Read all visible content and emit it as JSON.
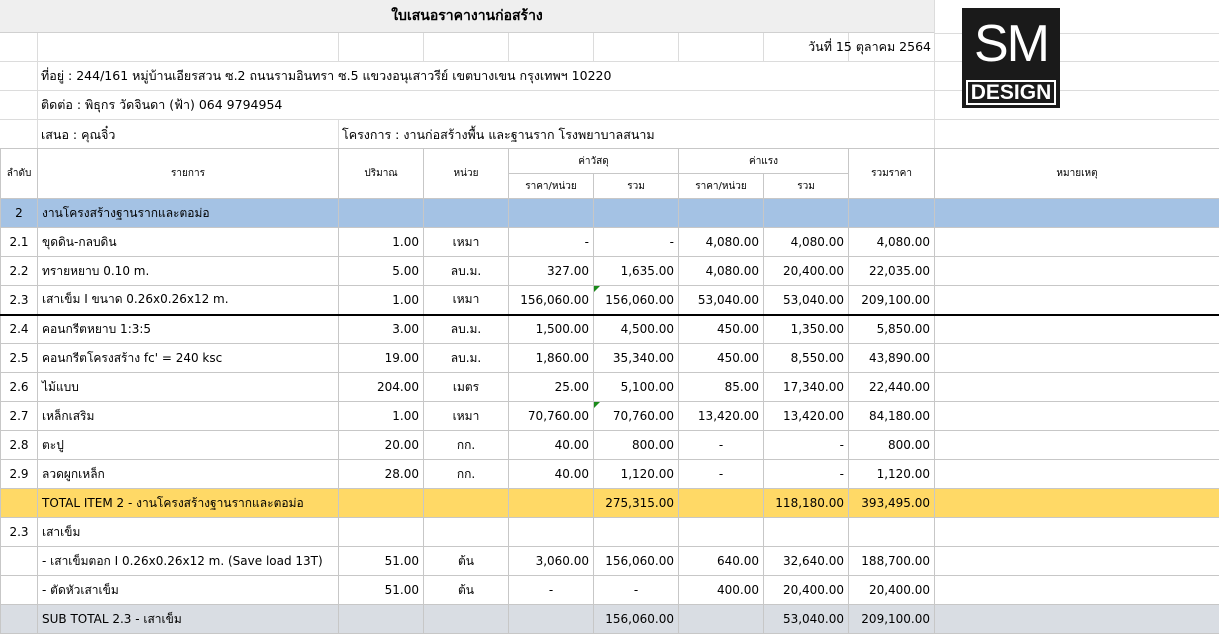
{
  "sheet": {
    "title": "ใบเสนอราคางานก่อสร้าง",
    "date": "วันที่ 15 ตุลาคม 2564",
    "address": "ที่อยู่ : 244/161 หมู่บ้านเอียรสวน ซ.2 ถนนรามอินทรา ซ.5 แขวงอนุเสาวรีย์ เขตบางเขน กรุงเทพฯ 10220",
    "contact": "ติดต่อ : พิธุกร วัดจินดา (ฟ้า) 064 9794954",
    "proposer": "เสนอ : คุณจิ๋ว",
    "project": "โครงการ : งานก่อสร้างพื้น และฐานราก โรงพยาบาลสนาม"
  },
  "logo": {
    "top": "SM",
    "bottom": "DESIGN"
  },
  "columns": {
    "no": "ลำดับ",
    "item": "รายการ",
    "qty": "ปริมาณ",
    "unit": "หน่วย",
    "material": "ค่าวัสดุ",
    "labor": "ค่าแรง",
    "price_per_unit": "ราคา/หน่วย",
    "sum": "รวม",
    "total": "รวมราคา",
    "remark": "หมายเหตุ"
  },
  "section": {
    "no": "2",
    "item": "งานโครงสร้างฐานรากและตอม่อ"
  },
  "rows": [
    {
      "no": "2.1",
      "item": "ขุดดิน-กลบดิน",
      "qty": "1.00",
      "unit": "เหมา",
      "mat_unit": "-",
      "mat_sum": "-",
      "lab_unit": "4,080.00",
      "lab_sum": "4,080.00",
      "total": "4,080.00"
    },
    {
      "no": "2.2",
      "item": "ทรายหยาบ 0.10 m.",
      "qty": "5.00",
      "unit": "ลบ.ม.",
      "mat_unit": "327.00",
      "mat_sum": "1,635.00",
      "lab_unit": "4,080.00",
      "lab_sum": "20,400.00",
      "total": "22,035.00"
    },
    {
      "no": "2.3",
      "item": "เสาเข็ม I ขนาด 0.26x0.26x12 m.",
      "qty": "1.00",
      "unit": "เหมา",
      "mat_unit": "156,060.00",
      "mat_sum": "156,060.00",
      "lab_unit": "53,040.00",
      "lab_sum": "53,040.00",
      "total": "209,100.00"
    },
    {
      "no": "2.4",
      "item": "คอนกรีตหยาบ 1:3:5",
      "qty": "3.00",
      "unit": "ลบ.ม.",
      "mat_unit": "1,500.00",
      "mat_sum": "4,500.00",
      "lab_unit": "450.00",
      "lab_sum": "1,350.00",
      "total": "5,850.00"
    },
    {
      "no": "2.5",
      "item": "คอนกรีตโครงสร้าง fc' = 240 ksc",
      "qty": "19.00",
      "unit": "ลบ.ม.",
      "mat_unit": "1,860.00",
      "mat_sum": "35,340.00",
      "lab_unit": "450.00",
      "lab_sum": "8,550.00",
      "total": "43,890.00"
    },
    {
      "no": "2.6",
      "item": "ไม้แบบ",
      "qty": "204.00",
      "unit": "เมตร",
      "mat_unit": "25.00",
      "mat_sum": "5,100.00",
      "lab_unit": "85.00",
      "lab_sum": "17,340.00",
      "total": "22,440.00"
    },
    {
      "no": "2.7",
      "item": "เหล็กเสริม",
      "qty": "1.00",
      "unit": "เหมา",
      "mat_unit": "70,760.00",
      "mat_sum": "70,760.00",
      "lab_unit": "13,420.00",
      "lab_sum": "13,420.00",
      "total": "84,180.00"
    },
    {
      "no": "2.8",
      "item": "ตะปู",
      "qty": "20.00",
      "unit": "กก.",
      "mat_unit": "40.00",
      "mat_sum": "800.00",
      "lab_unit": "-",
      "lab_sum": "-",
      "total": "800.00"
    },
    {
      "no": "2.9",
      "item": "ลวดผูกเหล็ก",
      "qty": "28.00",
      "unit": "กก.",
      "mat_unit": "40.00",
      "mat_sum": "1,120.00",
      "lab_unit": "-",
      "lab_sum": "-",
      "total": "1,120.00"
    }
  ],
  "total_item": {
    "label": "TOTAL ITEM 2 - งานโครงสร้างฐานรากและตอม่อ",
    "mat_sum": "275,315.00",
    "lab_sum": "118,180.00",
    "total": "393,495.00"
  },
  "sub_section": {
    "no": "2.3",
    "item": "เสาเข็ม"
  },
  "sub_rows": [
    {
      "no": "",
      "item": "- เสาเข็มตอก I 0.26x0.26x12 m. (Save load 13T)",
      "qty": "51.00",
      "unit": "ต้น",
      "mat_unit": "3,060.00",
      "mat_sum": "156,060.00",
      "lab_unit": "640.00",
      "lab_sum": "32,640.00",
      "total": "188,700.00"
    },
    {
      "no": "",
      "item": "- ตัดหัวเสาเข็ม",
      "qty": "51.00",
      "unit": "ต้น",
      "mat_unit": "-",
      "mat_sum": "-",
      "lab_unit": "400.00",
      "lab_sum": "20,400.00",
      "total": "20,400.00"
    }
  ],
  "sub_total": {
    "label": "SUB TOTAL 2.3 - เสาเข็ม",
    "mat_sum": "156,060.00",
    "lab_sum": "53,040.00",
    "total": "209,100.00"
  }
}
